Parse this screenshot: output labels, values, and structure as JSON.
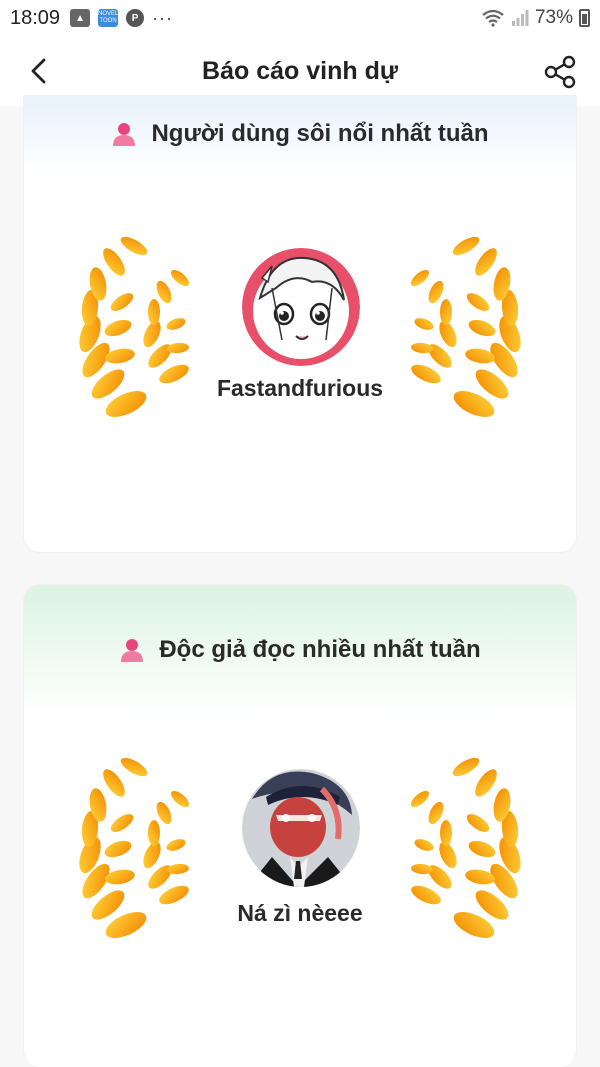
{
  "status_bar": {
    "time": "18:09",
    "more": "···",
    "novel_icon_text": "NOVEL TOON",
    "pin_icon_text": "P",
    "battery": "73%",
    "icons": [
      "gallery-icon",
      "novel-toon-icon",
      "pinterest-icon",
      "wifi-icon",
      "signal-icon",
      "battery-icon"
    ]
  },
  "header": {
    "title": "Báo cáo vinh dự",
    "icons": [
      "back-icon",
      "share-icon"
    ]
  },
  "sections": [
    {
      "title": "Người dùng sôi nổi nhất tuần",
      "winner_name": "Fastandfurious",
      "header_color": "#e9f1fc"
    },
    {
      "title": "Độc giả đọc nhiều nhất tuần",
      "winner_name": "Ná zì nèeee",
      "header_color": "#dcf3e2"
    }
  ],
  "colors": {
    "accent_pink": "#e8457c",
    "laurel_gold": "#f7b500",
    "laurel_orange": "#f08a00"
  }
}
